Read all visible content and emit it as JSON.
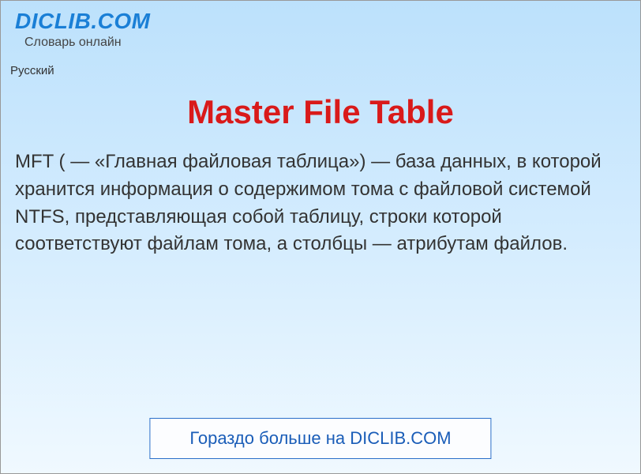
{
  "header": {
    "site_name": "DICLIB.COM",
    "tagline": "Словарь онлайн"
  },
  "language_label": "Русский",
  "article": {
    "title": "Master File Table",
    "definition": "MFT ( — «Главная файловая таблица») — база данных, в которой хранится информация о содержимом тома с файловой системой NTFS, представляющая собой таблицу, строки которой соответствуют файлам тома, а столбцы — атрибутам файлов."
  },
  "footer": {
    "button_label": "Гораздо больше на DICLIB.COM"
  }
}
